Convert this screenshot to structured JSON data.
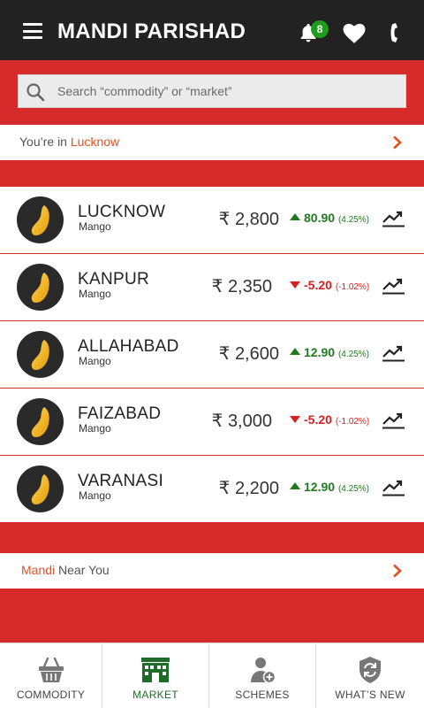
{
  "header": {
    "title": "MANDI PARISHAD",
    "notification_count": "8"
  },
  "search": {
    "placeholder": "Search “commodity” or “market”"
  },
  "location": {
    "prefix": "You’re in",
    "city": "Lucknow"
  },
  "currency_symbol": "₹",
  "markets": [
    {
      "name": "LUCKNOW",
      "commodity": "Mango",
      "price": "2,800",
      "direction": "up",
      "change": "80.90",
      "percent": "(4.25%)"
    },
    {
      "name": "KANPUR",
      "commodity": "Mango",
      "price": "2,350",
      "direction": "down",
      "change": "-5.20",
      "percent": "(-1.02%)"
    },
    {
      "name": "ALLAHABAD",
      "commodity": "Mango",
      "price": "2,600",
      "direction": "up",
      "change": "12.90",
      "percent": "(4.25%)"
    },
    {
      "name": "FAIZABAD",
      "commodity": "Mango",
      "price": "3,000",
      "direction": "down",
      "change": "-5.20",
      "percent": "(-1.02%)"
    },
    {
      "name": "VARANASI",
      "commodity": "Mango",
      "price": "2,200",
      "direction": "up",
      "change": "12.90",
      "percent": "(4.25%)"
    }
  ],
  "nearby": {
    "highlight": "Mandi",
    "rest": "Near You"
  },
  "bottom_nav": [
    {
      "label": "COMMODITY",
      "icon": "basket-icon",
      "active": false
    },
    {
      "label": "MARKET",
      "icon": "market-building-icon",
      "active": true
    },
    {
      "label": "SCHEMES",
      "icon": "user-add-icon",
      "active": false
    },
    {
      "label": "WHAT’S NEW",
      "icon": "refresh-shield-icon",
      "active": false
    }
  ],
  "colors": {
    "brand_red": "#d72b2b",
    "header_bg": "#222222",
    "up_green": "#217a21",
    "down_red": "#d91f1f",
    "accent_orange": "#e2511f",
    "active_green": "#1f6b2a"
  }
}
